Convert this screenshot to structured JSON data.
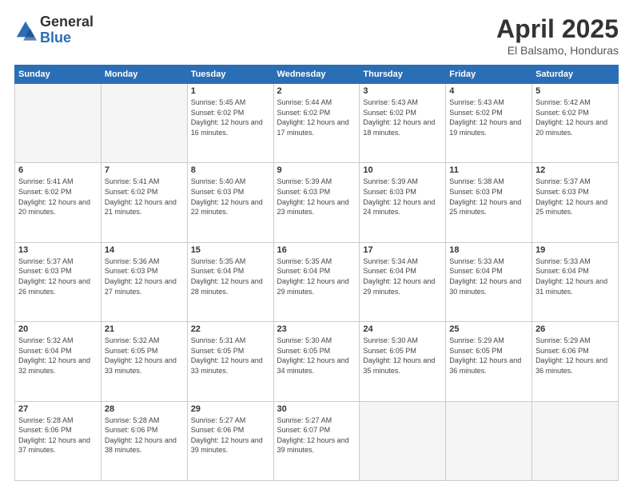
{
  "logo": {
    "general": "General",
    "blue": "Blue"
  },
  "title": "April 2025",
  "location": "El Balsamo, Honduras",
  "days_header": [
    "Sunday",
    "Monday",
    "Tuesday",
    "Wednesday",
    "Thursday",
    "Friday",
    "Saturday"
  ],
  "weeks": [
    [
      {
        "num": "",
        "info": ""
      },
      {
        "num": "",
        "info": ""
      },
      {
        "num": "1",
        "info": "Sunrise: 5:45 AM\nSunset: 6:02 PM\nDaylight: 12 hours and 16 minutes."
      },
      {
        "num": "2",
        "info": "Sunrise: 5:44 AM\nSunset: 6:02 PM\nDaylight: 12 hours and 17 minutes."
      },
      {
        "num": "3",
        "info": "Sunrise: 5:43 AM\nSunset: 6:02 PM\nDaylight: 12 hours and 18 minutes."
      },
      {
        "num": "4",
        "info": "Sunrise: 5:43 AM\nSunset: 6:02 PM\nDaylight: 12 hours and 19 minutes."
      },
      {
        "num": "5",
        "info": "Sunrise: 5:42 AM\nSunset: 6:02 PM\nDaylight: 12 hours and 20 minutes."
      }
    ],
    [
      {
        "num": "6",
        "info": "Sunrise: 5:41 AM\nSunset: 6:02 PM\nDaylight: 12 hours and 20 minutes."
      },
      {
        "num": "7",
        "info": "Sunrise: 5:41 AM\nSunset: 6:02 PM\nDaylight: 12 hours and 21 minutes."
      },
      {
        "num": "8",
        "info": "Sunrise: 5:40 AM\nSunset: 6:03 PM\nDaylight: 12 hours and 22 minutes."
      },
      {
        "num": "9",
        "info": "Sunrise: 5:39 AM\nSunset: 6:03 PM\nDaylight: 12 hours and 23 minutes."
      },
      {
        "num": "10",
        "info": "Sunrise: 5:39 AM\nSunset: 6:03 PM\nDaylight: 12 hours and 24 minutes."
      },
      {
        "num": "11",
        "info": "Sunrise: 5:38 AM\nSunset: 6:03 PM\nDaylight: 12 hours and 25 minutes."
      },
      {
        "num": "12",
        "info": "Sunrise: 5:37 AM\nSunset: 6:03 PM\nDaylight: 12 hours and 25 minutes."
      }
    ],
    [
      {
        "num": "13",
        "info": "Sunrise: 5:37 AM\nSunset: 6:03 PM\nDaylight: 12 hours and 26 minutes."
      },
      {
        "num": "14",
        "info": "Sunrise: 5:36 AM\nSunset: 6:03 PM\nDaylight: 12 hours and 27 minutes."
      },
      {
        "num": "15",
        "info": "Sunrise: 5:35 AM\nSunset: 6:04 PM\nDaylight: 12 hours and 28 minutes."
      },
      {
        "num": "16",
        "info": "Sunrise: 5:35 AM\nSunset: 6:04 PM\nDaylight: 12 hours and 29 minutes."
      },
      {
        "num": "17",
        "info": "Sunrise: 5:34 AM\nSunset: 6:04 PM\nDaylight: 12 hours and 29 minutes."
      },
      {
        "num": "18",
        "info": "Sunrise: 5:33 AM\nSunset: 6:04 PM\nDaylight: 12 hours and 30 minutes."
      },
      {
        "num": "19",
        "info": "Sunrise: 5:33 AM\nSunset: 6:04 PM\nDaylight: 12 hours and 31 minutes."
      }
    ],
    [
      {
        "num": "20",
        "info": "Sunrise: 5:32 AM\nSunset: 6:04 PM\nDaylight: 12 hours and 32 minutes."
      },
      {
        "num": "21",
        "info": "Sunrise: 5:32 AM\nSunset: 6:05 PM\nDaylight: 12 hours and 33 minutes."
      },
      {
        "num": "22",
        "info": "Sunrise: 5:31 AM\nSunset: 6:05 PM\nDaylight: 12 hours and 33 minutes."
      },
      {
        "num": "23",
        "info": "Sunrise: 5:30 AM\nSunset: 6:05 PM\nDaylight: 12 hours and 34 minutes."
      },
      {
        "num": "24",
        "info": "Sunrise: 5:30 AM\nSunset: 6:05 PM\nDaylight: 12 hours and 35 minutes."
      },
      {
        "num": "25",
        "info": "Sunrise: 5:29 AM\nSunset: 6:05 PM\nDaylight: 12 hours and 36 minutes."
      },
      {
        "num": "26",
        "info": "Sunrise: 5:29 AM\nSunset: 6:06 PM\nDaylight: 12 hours and 36 minutes."
      }
    ],
    [
      {
        "num": "27",
        "info": "Sunrise: 5:28 AM\nSunset: 6:06 PM\nDaylight: 12 hours and 37 minutes."
      },
      {
        "num": "28",
        "info": "Sunrise: 5:28 AM\nSunset: 6:06 PM\nDaylight: 12 hours and 38 minutes."
      },
      {
        "num": "29",
        "info": "Sunrise: 5:27 AM\nSunset: 6:06 PM\nDaylight: 12 hours and 39 minutes."
      },
      {
        "num": "30",
        "info": "Sunrise: 5:27 AM\nSunset: 6:07 PM\nDaylight: 12 hours and 39 minutes."
      },
      {
        "num": "",
        "info": ""
      },
      {
        "num": "",
        "info": ""
      },
      {
        "num": "",
        "info": ""
      }
    ]
  ]
}
